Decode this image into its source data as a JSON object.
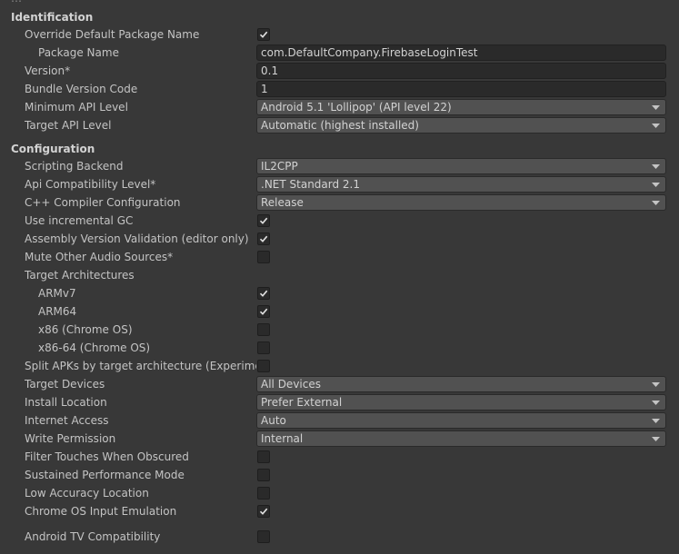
{
  "identification": {
    "header": "Identification",
    "override_default_package_name": {
      "label": "Override Default Package Name",
      "checked": true
    },
    "package_name": {
      "label": "Package Name",
      "value": "com.DefaultCompany.FirebaseLoginTest"
    },
    "version": {
      "label": "Version*",
      "value": "0.1"
    },
    "bundle_version_code": {
      "label": "Bundle Version Code",
      "value": "1"
    },
    "minimum_api_level": {
      "label": "Minimum API Level",
      "value": "Android 5.1 'Lollipop' (API level 22)"
    },
    "target_api_level": {
      "label": "Target API Level",
      "value": "Automatic (highest installed)"
    }
  },
  "configuration": {
    "header": "Configuration",
    "scripting_backend": {
      "label": "Scripting Backend",
      "value": "IL2CPP"
    },
    "api_compatibility_level": {
      "label": "Api Compatibility Level*",
      "value": ".NET Standard 2.1"
    },
    "cpp_compiler_configuration": {
      "label": "C++ Compiler Configuration",
      "value": "Release"
    },
    "use_incremental_gc": {
      "label": "Use incremental GC",
      "checked": true
    },
    "assembly_version_validation": {
      "label": "Assembly Version Validation (editor only)",
      "checked": true
    },
    "mute_other_audio_sources": {
      "label": "Mute Other Audio Sources*",
      "checked": false
    },
    "target_architectures": {
      "label": "Target Architectures",
      "armv7": {
        "label": "ARMv7",
        "checked": true
      },
      "arm64": {
        "label": "ARM64",
        "checked": true
      },
      "x86": {
        "label": "x86 (Chrome OS)",
        "checked": false
      },
      "x86_64": {
        "label": "x86-64 (Chrome OS)",
        "checked": false
      }
    },
    "split_apks": {
      "label": "Split APKs by target architecture (Experimental)",
      "checked": false
    },
    "target_devices": {
      "label": "Target Devices",
      "value": "All Devices"
    },
    "install_location": {
      "label": "Install Location",
      "value": "Prefer External"
    },
    "internet_access": {
      "label": "Internet Access",
      "value": "Auto"
    },
    "write_permission": {
      "label": "Write Permission",
      "value": "Internal"
    },
    "filter_touches_when_obscured": {
      "label": "Filter Touches When Obscured",
      "checked": false
    },
    "sustained_performance_mode": {
      "label": "Sustained Performance Mode",
      "checked": false
    },
    "low_accuracy_location": {
      "label": "Low Accuracy Location",
      "checked": false
    },
    "chrome_os_input_emulation": {
      "label": "Chrome OS Input Emulation",
      "checked": true
    },
    "android_tv_compatibility": {
      "label": "Android TV Compatibility",
      "checked": false
    }
  }
}
